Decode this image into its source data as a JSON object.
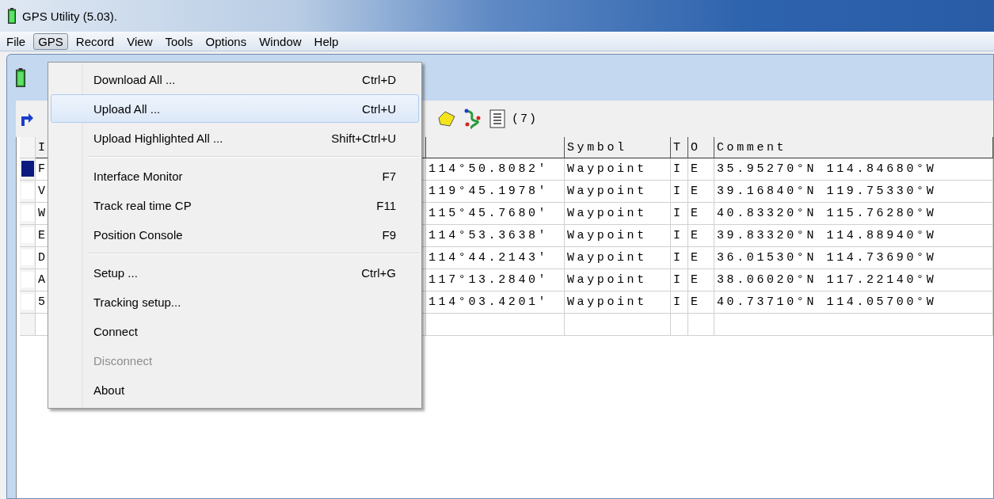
{
  "window": {
    "title": "GPS Utility (5.03)."
  },
  "menu_bar": [
    {
      "label": "File",
      "selected": false
    },
    {
      "label": "GPS",
      "selected": true
    },
    {
      "label": "Record",
      "selected": false
    },
    {
      "label": "View",
      "selected": false
    },
    {
      "label": "Tools",
      "selected": false
    },
    {
      "label": "Options",
      "selected": false
    },
    {
      "label": "Window",
      "selected": false
    },
    {
      "label": "Help",
      "selected": false
    }
  ],
  "open_menu": {
    "items": [
      {
        "kind": "item",
        "label": "Download All ...",
        "shortcut": "Ctrl+D",
        "selected": false,
        "disabled": false
      },
      {
        "kind": "item",
        "label": "Upload All ...",
        "shortcut": "Ctrl+U",
        "selected": true,
        "disabled": false
      },
      {
        "kind": "item",
        "label": "Upload Highlighted All ...",
        "shortcut": "Shift+Ctrl+U",
        "selected": false,
        "disabled": false
      },
      {
        "kind": "separator"
      },
      {
        "kind": "item",
        "label": "Interface Monitor",
        "shortcut": "F7",
        "selected": false,
        "disabled": false
      },
      {
        "kind": "item",
        "label": "Track real time CP",
        "shortcut": "F11",
        "selected": false,
        "disabled": false
      },
      {
        "kind": "item",
        "label": "Position Console",
        "shortcut": "F9",
        "selected": false,
        "disabled": false
      },
      {
        "kind": "separator"
      },
      {
        "kind": "item",
        "label": "Setup ...",
        "shortcut": "Ctrl+G",
        "selected": false,
        "disabled": false
      },
      {
        "kind": "item",
        "label": "Tracking setup...",
        "selected": false,
        "disabled": false
      },
      {
        "kind": "item",
        "label": "Connect",
        "selected": false,
        "disabled": false
      },
      {
        "kind": "item",
        "label": "Disconnect",
        "selected": false,
        "disabled": true
      },
      {
        "kind": "item",
        "label": "About",
        "selected": false,
        "disabled": false
      }
    ]
  },
  "toolbar": {
    "count": "(7)"
  },
  "table": {
    "columns": [
      "I",
      "Symbol",
      "T",
      "O",
      "Comment"
    ],
    "rows": [
      {
        "selected": true,
        "column_1": "F",
        "column_2": "114°50.8082'",
        "symbol": "Waypoint",
        "t": "I",
        "o": "E",
        "comment": "35.95270°N 114.84680°W"
      },
      {
        "selected": false,
        "column_1": "V",
        "column_2": "119°45.1978'",
        "symbol": "Waypoint",
        "t": "I",
        "o": "E",
        "comment": "39.16840°N 119.75330°W"
      },
      {
        "selected": false,
        "column_1": "W",
        "column_2": "115°45.7680'",
        "symbol": "Waypoint",
        "t": "I",
        "o": "E",
        "comment": "40.83320°N 115.76280°W"
      },
      {
        "selected": false,
        "column_1": "E",
        "column_2": "114°53.3638'",
        "symbol": "Waypoint",
        "t": "I",
        "o": "E",
        "comment": "39.83320°N 114.88940°W"
      },
      {
        "selected": false,
        "column_1": "D",
        "column_2": "114°44.2143'",
        "symbol": "Waypoint",
        "t": "I",
        "o": "E",
        "comment": "36.01530°N 114.73690°W"
      },
      {
        "selected": false,
        "column_1": "A",
        "column_2": "117°13.2840'",
        "symbol": "Waypoint",
        "t": "I",
        "o": "E",
        "comment": "38.06020°N 117.22140°W"
      },
      {
        "selected": false,
        "column_1": "5",
        "column_2": "114°03.4201'",
        "symbol": "Waypoint",
        "t": "I",
        "o": "E",
        "comment": "40.73710°N 114.05700°W"
      }
    ]
  }
}
